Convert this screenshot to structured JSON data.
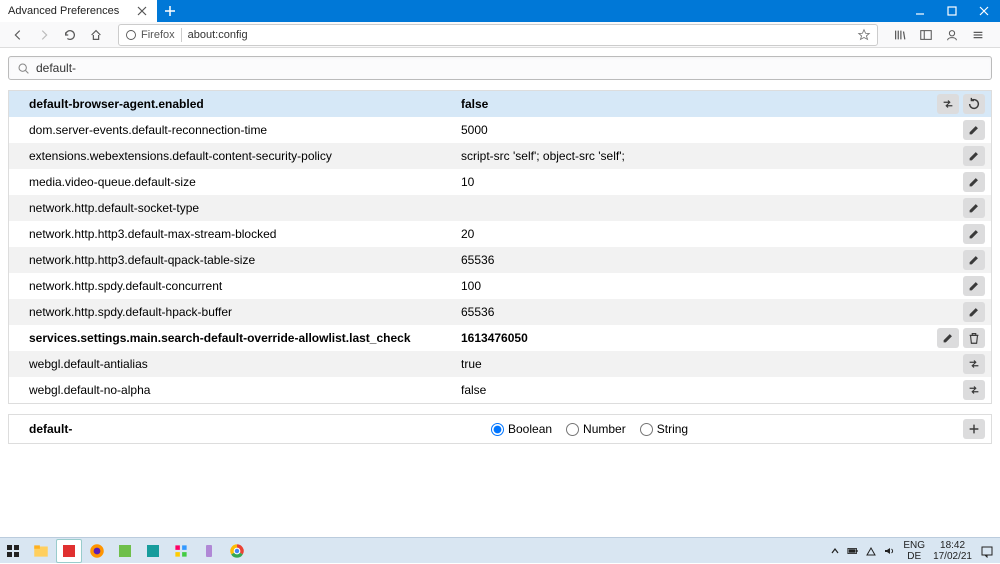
{
  "window": {
    "tab_title": "Advanced Preferences"
  },
  "urlbar": {
    "identity": "Firefox",
    "url": "about:config"
  },
  "search": {
    "value": "default-"
  },
  "prefs": [
    {
      "name": "default-browser-agent.enabled",
      "value": "false",
      "bold": true,
      "highlight": true,
      "action": "toggle",
      "secondary": "reset"
    },
    {
      "name": "dom.server-events.default-reconnection-time",
      "value": "5000",
      "bold": false,
      "action": "edit"
    },
    {
      "name": "extensions.webextensions.default-content-security-policy",
      "value": "script-src 'self'; object-src 'self';",
      "bold": false,
      "action": "edit"
    },
    {
      "name": "media.video-queue.default-size",
      "value": "10",
      "bold": false,
      "action": "edit"
    },
    {
      "name": "network.http.default-socket-type",
      "value": "",
      "bold": false,
      "action": "edit"
    },
    {
      "name": "network.http.http3.default-max-stream-blocked",
      "value": "20",
      "bold": false,
      "action": "edit"
    },
    {
      "name": "network.http.http3.default-qpack-table-size",
      "value": "65536",
      "bold": false,
      "action": "edit"
    },
    {
      "name": "network.http.spdy.default-concurrent",
      "value": "100",
      "bold": false,
      "action": "edit"
    },
    {
      "name": "network.http.spdy.default-hpack-buffer",
      "value": "65536",
      "bold": false,
      "action": "edit"
    },
    {
      "name": "services.settings.main.search-default-override-allowlist.last_check",
      "value": "1613476050",
      "bold": true,
      "action": "edit",
      "secondary": "delete"
    },
    {
      "name": "webgl.default-antialias",
      "value": "true",
      "bold": false,
      "action": "toggle"
    },
    {
      "name": "webgl.default-no-alpha",
      "value": "false",
      "bold": false,
      "action": "toggle"
    }
  ],
  "add_row": {
    "name": "default-",
    "options": {
      "boolean": "Boolean",
      "number": "Number",
      "string": "String"
    },
    "selected": "boolean"
  },
  "tray": {
    "lang1": "ENG",
    "lang2": "DE",
    "time": "18:42",
    "date": "17/02/21"
  }
}
